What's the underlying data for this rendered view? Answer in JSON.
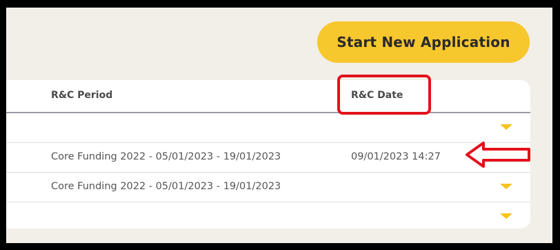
{
  "actions": {
    "start_new_application": "Start New Application"
  },
  "table": {
    "columns": [
      "R&C Period",
      "R&C Date"
    ],
    "rows": [
      {
        "period": "",
        "date": ""
      },
      {
        "period": "Core Funding 2022 - 05/01/2023 - 19/01/2023",
        "date": "09/01/2023 14:27"
      },
      {
        "period": "Core Funding 2022 - 05/01/2023 - 19/01/2023",
        "date": ""
      },
      {
        "period": "",
        "date": ""
      }
    ]
  },
  "annotation": {
    "color": "#e3111b"
  },
  "colors": {
    "accent": "#f7c72e",
    "background": "#f2eee8"
  }
}
